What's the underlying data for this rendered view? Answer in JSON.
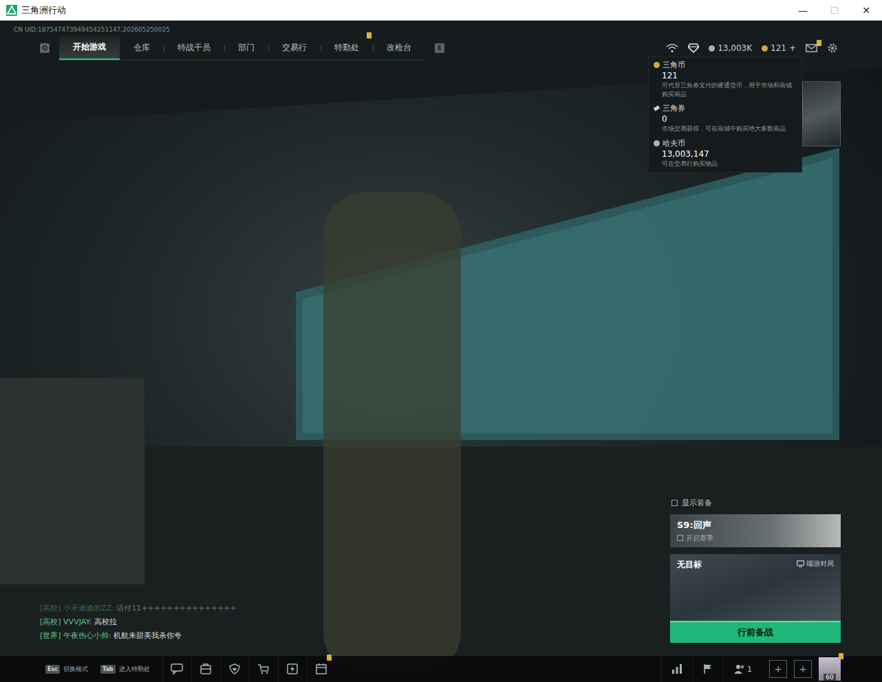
{
  "window": {
    "title": "三角洲行动",
    "controls": [
      "—",
      "☐",
      "✕"
    ]
  },
  "uid": "CN UID:187547473949454251147,202605250025",
  "nav": {
    "prev_key": "Q",
    "next_key": "E",
    "tabs": [
      {
        "label": "开始游戏",
        "selected": true,
        "badge": false
      },
      {
        "label": "仓库",
        "selected": false,
        "badge": false
      },
      {
        "label": "特战干员",
        "selected": false,
        "badge": false
      },
      {
        "label": "部门",
        "selected": false,
        "badge": false
      },
      {
        "label": "交易行",
        "selected": false,
        "badge": false
      },
      {
        "label": "特勤处",
        "selected": false,
        "badge": true
      },
      {
        "label": "改枪台",
        "selected": false,
        "badge": false
      }
    ]
  },
  "hud": {
    "haf_coin": "13,003K",
    "delta_coin": "121",
    "add": "+",
    "mail_badge": true
  },
  "tooltip": {
    "items": [
      {
        "name": "三角币",
        "value": "121",
        "desc": "可代替三角券支付的硬通货币，用于市场和商城购买商品"
      },
      {
        "name": "三角券",
        "value": "0",
        "desc": "市场交易获得，可在商城中购买绝大多数商品"
      },
      {
        "name": "哈夫币",
        "value": "13,003,147",
        "desc": "可在交易行购买物品"
      }
    ]
  },
  "right": {
    "show_gear": {
      "label": "显示装备",
      "checked": false
    },
    "season": {
      "title": "S9:回声",
      "subtitle": "开启赛季"
    },
    "mode": {
      "title": "无目标",
      "tag": "端游对局"
    },
    "start_button": "行前备战"
  },
  "chat": [
    {
      "channel": "[高校]",
      "name": "小禾迪迪的ZZ:",
      "text": "话付11+++++++++++++++",
      "faded": true
    },
    {
      "channel": "[高校]",
      "name": "VVVJAY:",
      "text": "高校拉",
      "faded": false
    },
    {
      "channel": "[世界]",
      "name": "午夜伤心小帅:",
      "text": "机航来甜美我杀你夸",
      "faded": false
    }
  ],
  "bottom": {
    "shortcuts": [
      {
        "key": "Esc",
        "label": "切换模式"
      },
      {
        "key": "Tab",
        "label": "进入特勤处"
      }
    ],
    "tool_badges": [
      false,
      false,
      false,
      false,
      false,
      true
    ],
    "friends_count": "1",
    "plus": [
      "+",
      "+"
    ],
    "avatar_level": "60",
    "avatar_badge": true
  }
}
